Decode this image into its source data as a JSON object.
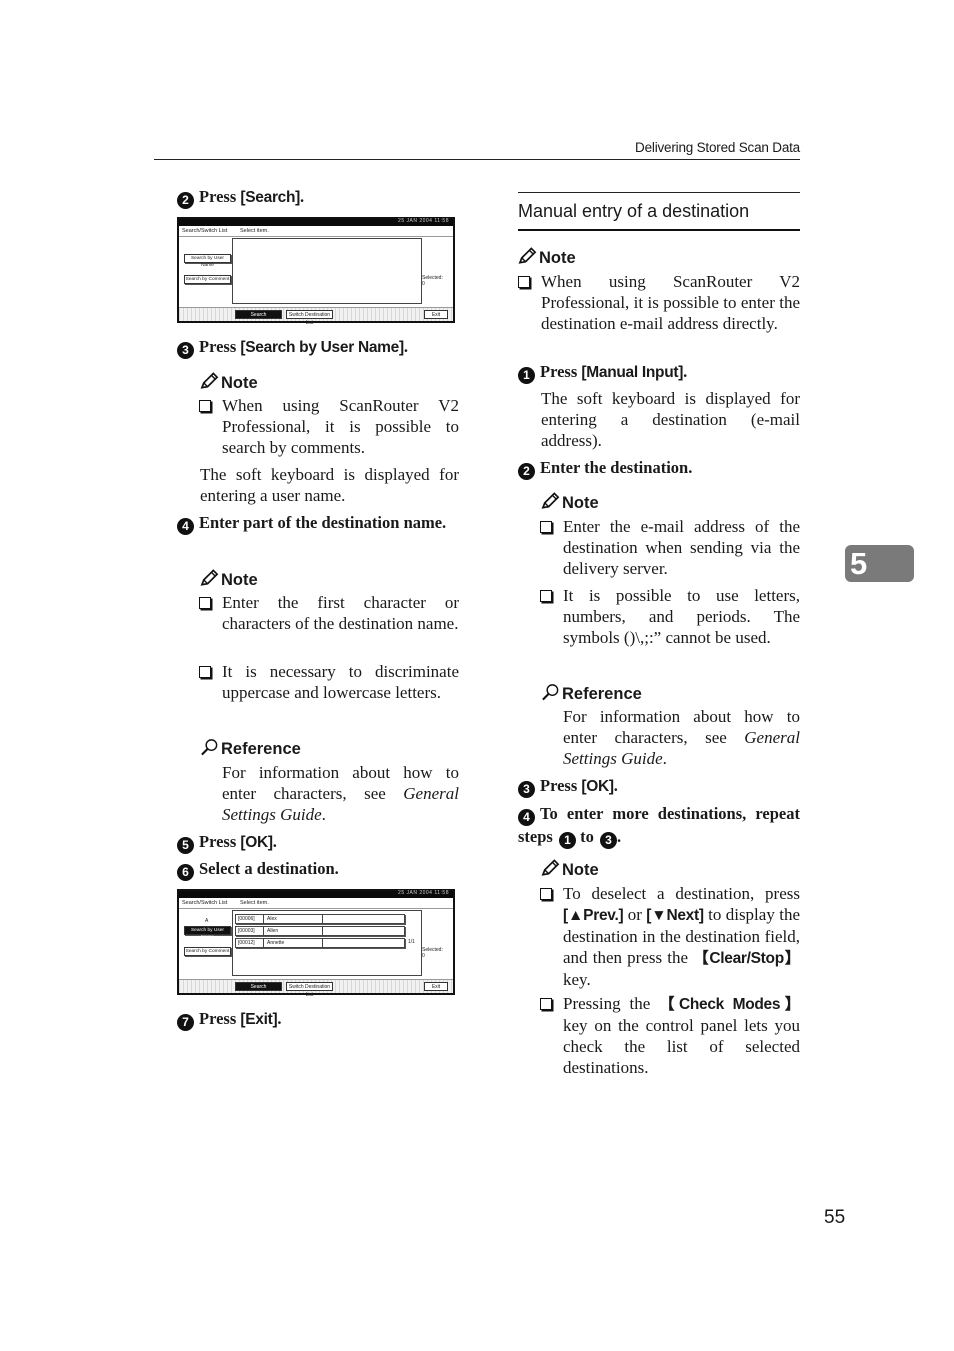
{
  "header": {
    "running_title": "Delivering Stored Scan Data"
  },
  "chapter_tab": "5",
  "page_number": "55",
  "left_column": {
    "step2": {
      "num": "2",
      "pre": "Press ",
      "key": "[Search]",
      "post": "."
    },
    "screen1": {
      "clock": "25 JAN  2004 11:58",
      "title_left": "Search/Switch List",
      "title_right": "Select item.",
      "btn_user": "Search by User Name",
      "btn_comment": "Search by Comment",
      "selected_label": "Selected:",
      "selected_count": "0",
      "btn_search": "Search",
      "btn_switch": "Switch Destination List",
      "btn_exit": "Exit"
    },
    "step3": {
      "num": "3",
      "pre": "Press ",
      "key": "[Search by User Name]",
      "post": "."
    },
    "note1": {
      "heading": "Note",
      "items": [
        "When using ScanRouter V2 Professional, it is possible to search by comments."
      ]
    },
    "text1": "The soft keyboard is displayed for entering a user name.",
    "step4": {
      "num": "4",
      "text": "Enter part of the destination name."
    },
    "note2": {
      "heading": "Note",
      "items": [
        "Enter the first character or characters of the destination name.",
        "It is necessary to discriminate uppercase and lowercase letters."
      ]
    },
    "reference1": {
      "heading": "Reference",
      "pre": "For information about how to enter characters, see ",
      "italic": "General Settings Guide",
      "post": "."
    },
    "step5": {
      "num": "5",
      "pre": "Press ",
      "key": "[OK]",
      "post": "."
    },
    "step6": {
      "num": "6",
      "text": "Select a destination."
    },
    "screen2": {
      "clock": "25 JAN  2004 11:58",
      "title_left": "Search/Switch List",
      "title_right": "Select item.",
      "search_term": "A",
      "btn_user": "Search by User Name",
      "btn_comment": "Search by Comment",
      "rows": [
        {
          "id": "[00006]",
          "name": "Alex"
        },
        {
          "id": "[00003]",
          "name": "Allen"
        },
        {
          "id": "[00012]",
          "name": "Annette"
        }
      ],
      "page": "1/1",
      "selected_label": "Selected:",
      "selected_count": "0",
      "btn_search": "Search",
      "btn_switch": "Switch Destination List",
      "btn_exit": "Exit"
    },
    "step7": {
      "num": "7",
      "pre": "Press ",
      "key": "[Exit]",
      "post": "."
    }
  },
  "right_column": {
    "section_title": "Manual entry of a destination",
    "note0": {
      "heading": "Note",
      "items": [
        "When using ScanRouter V2 Professional, it is possible to enter the destination e-mail address directly."
      ]
    },
    "step1": {
      "num": "1",
      "pre": "Press ",
      "key": "[Manual Input]",
      "post": "."
    },
    "text1": "The soft keyboard is displayed for entering a destination (e-mail address).",
    "step2": {
      "num": "2",
      "text": "Enter the destination."
    },
    "note1": {
      "heading": "Note",
      "items": [
        "Enter the e-mail address of the destination when sending via the delivery server.",
        "It is possible to use letters, numbers, and periods. The symbols ()\\,;:” cannot be used."
      ]
    },
    "reference1": {
      "heading": "Reference",
      "pre": "For information about how to enter characters, see ",
      "italic": "General Settings Guide",
      "post": "."
    },
    "step3": {
      "num": "3",
      "pre": "Press ",
      "key": "[OK]",
      "post": "."
    },
    "step4": {
      "num": "4",
      "pre": "To enter more destinations, repeat steps ",
      "ref_a": "1",
      "mid": " to ",
      "ref_b": "3",
      "post": "."
    },
    "note2": {
      "heading": "Note",
      "item1": {
        "a": "To deselect a destination, press ",
        "k1": "[▲Prev.]",
        "b": " or ",
        "k2": "[▼Next]",
        "c": " to display the destination in the destination field, and then press the ",
        "k3": "【Clear/Stop】",
        "d": " key."
      },
      "item2": {
        "a": "Pressing the ",
        "k1": "【Check Modes】",
        "b": " key on the control panel lets you check the list of selected destinations."
      }
    }
  }
}
